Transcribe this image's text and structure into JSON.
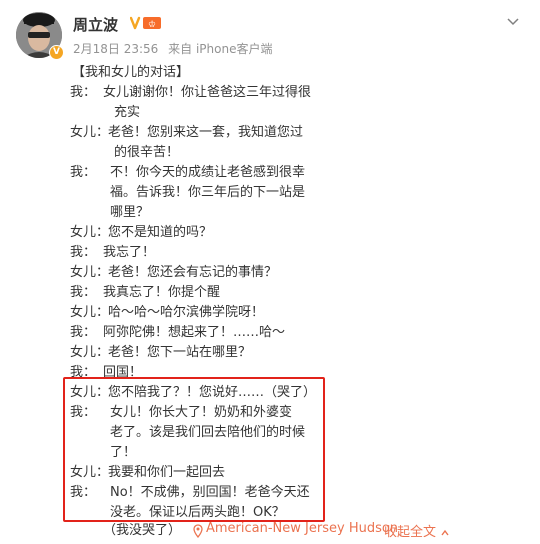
{
  "post": {
    "username": "周立波",
    "date": "2月18日 23:56",
    "source": "来自 iPhone客户端",
    "title": "【我和女儿的对话】",
    "lines": [
      {
        "speaker": "我：",
        "text": "女儿谢谢你！你让爸爸这三年过得很"
      },
      {
        "speaker": "",
        "text": "充实"
      },
      {
        "speaker": "女儿：",
        "text": "老爸！您别来这一套，我知道您过"
      },
      {
        "speaker": "",
        "text": "的很辛苦！"
      },
      {
        "speaker": "我：",
        "text": "不！你今天的成绩让老爸感到很幸"
      },
      {
        "speaker": "",
        "text": "福。告诉我！你三年后的下一站是"
      },
      {
        "speaker": "",
        "text": "哪里？"
      },
      {
        "speaker": "女儿：",
        "text": "您不是知道的吗？"
      },
      {
        "speaker": "我：",
        "text": "我忘了！"
      },
      {
        "speaker": "女儿：",
        "text": "老爸！您还会有忘记的事情？"
      },
      {
        "speaker": "我：",
        "text": "我真忘了！你提个醒"
      },
      {
        "speaker": "女儿：",
        "text": "哈～哈～哈尔滨佛学院呀！"
      },
      {
        "speaker": "我：",
        "text": "阿弥陀佛！想起来了！……哈～"
      },
      {
        "speaker": "女儿：",
        "text": "老爸！您下一站在哪里？"
      },
      {
        "speaker": "我：",
        "text": "回国！"
      },
      {
        "speaker": "女儿：",
        "text": "您不陪我了？！您说好……（哭了）"
      },
      {
        "speaker": "我：",
        "text": "女儿！你长大了！奶奶和外婆变"
      },
      {
        "speaker": "",
        "text": "老了。该是我们回去陪他们的时候"
      },
      {
        "speaker": "",
        "text": "了！"
      },
      {
        "speaker": "女儿：",
        "text": "我要和你们一起回去"
      },
      {
        "speaker": "我：",
        "text": "No！不成佛，别回国！老爸今天还"
      },
      {
        "speaker": "",
        "text": "没老。保证以后两头跑！OK？"
      }
    ],
    "last_line": "（我没哭了）",
    "location": "American-New Jersey Hudson",
    "expand_label": "收起全文"
  },
  "colors": {
    "accent": "#eb7350",
    "highlight_border": "#e2231a",
    "meta": "#939393"
  },
  "icons": [
    "avatar",
    "verified-badge",
    "vip-icon",
    "chevron-down-icon",
    "location-pin-icon",
    "collapse-arrow-icon"
  ]
}
